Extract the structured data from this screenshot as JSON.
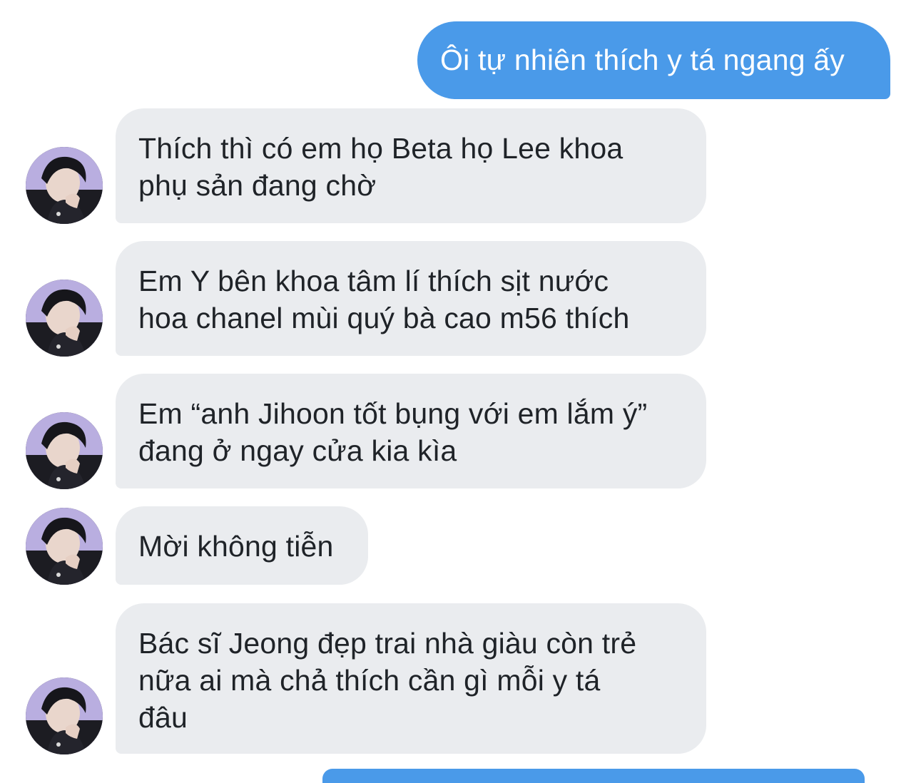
{
  "conversation": {
    "sent": [
      {
        "text": "Ôi tự nhiên thích y tá ngang ấy"
      }
    ],
    "received": [
      {
        "text": "Thích thì có em họ Beta họ Lee khoa phụ sản đang chờ",
        "lines": [
          "Thích thì có em họ Beta họ Lee khoa",
          "phụ sản đang chờ"
        ]
      },
      {
        "text": "Em Y bên khoa tâm lí thích sịt nước hoa chanel mùi quý bà cao m56 thích",
        "lines": [
          "Em Y bên khoa tâm lí thích sịt nước",
          "hoa chanel mùi quý bà cao m56 thích"
        ]
      },
      {
        "text": "Em “anh Jihoon tốt bụng với em lắm ý” đang ở ngay cửa kia kìa",
        "lines": [
          "Em “anh Jihoon tốt bụng với em lắm ý”",
          "đang ở ngay cửa kia kìa"
        ]
      },
      {
        "text": "Mời không tiễn",
        "lines": [
          "Mời không tiễn"
        ]
      },
      {
        "text": "Bác sĩ Jeong đẹp trai nhà giàu còn trẻ nữa ai mà chả thích cần gì mỗi y tá đâu",
        "lines": [
          "Bác sĩ Jeong đẹp trai nhà giàu còn trẻ",
          "nữa ai mà chả thích cần gì mỗi y tá",
          "đâu"
        ]
      }
    ]
  },
  "colors": {
    "sent_bubble": "#4a9ae9",
    "received_bubble": "#eaecef",
    "text_dark": "#1f2328",
    "text_light": "#ffffff"
  },
  "icons": {
    "avatar": "contact-avatar-photo"
  }
}
